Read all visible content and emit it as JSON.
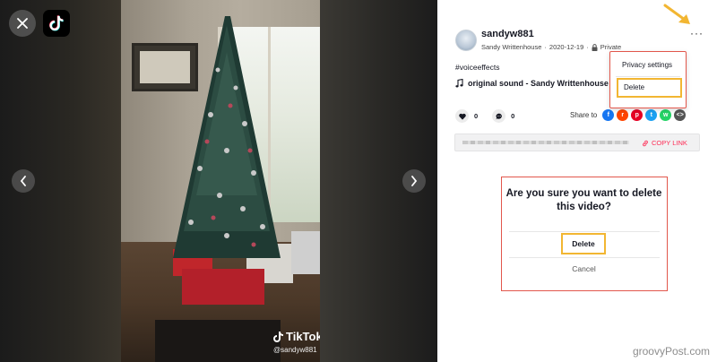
{
  "colors": {
    "accent": "#fe2c55",
    "highlight": "#f2b632",
    "annotation": "#e2574c"
  },
  "video": {
    "watermark_brand": "TikTok",
    "watermark_handle": "@sandyw881"
  },
  "post": {
    "username": "sandyw881",
    "author": "Sandy Writtenhouse",
    "date": "2020-12-19",
    "separator": "·",
    "visibility": "Private",
    "more_label": "···",
    "hashtag": "#voiceeffects",
    "sound": "original sound - Sandy Writtenhouse",
    "likes": "0",
    "comments": "0",
    "share_label": "Share to",
    "share_targets": [
      "facebook-icon",
      "reddit-icon",
      "pinterest-icon",
      "twitter-icon",
      "whatsapp-icon",
      "embed-icon"
    ],
    "copy_link_label": "COPY LINK"
  },
  "menu": {
    "privacy_label": "Privacy settings",
    "delete_label": "Delete"
  },
  "dialog": {
    "title": "Are you sure you want to delete this video?",
    "delete_label": "Delete",
    "cancel_label": "Cancel"
  },
  "site_watermark": "groovyPost.com"
}
